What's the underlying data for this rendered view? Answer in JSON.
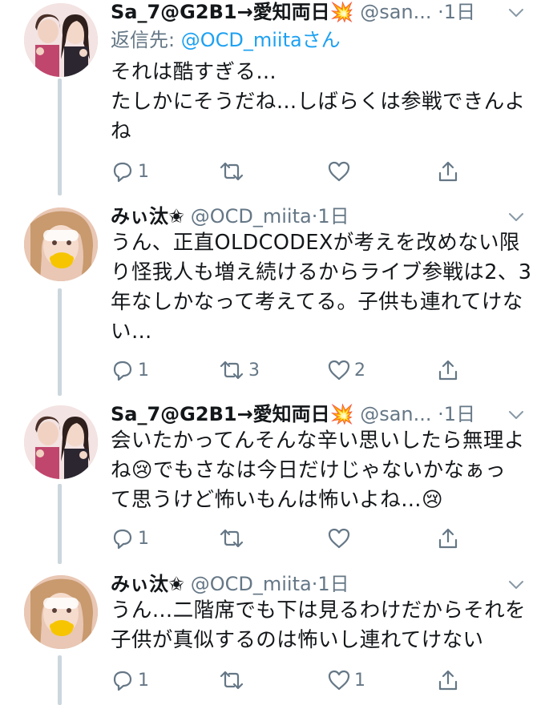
{
  "tweets": [
    {
      "name": "Sa_7@G2B1→愛知両日💥",
      "handle": "@san...",
      "time": "1日",
      "reply_prefix": "返信先: ",
      "reply_handle": "@OCD_miitaさん",
      "lines": [
        "それは酷すぎる…",
        "たしかにそうだね…しばらくは参戦できんよ",
        "ね"
      ],
      "reply_count": "1",
      "retweet_count": "",
      "like_count": ""
    },
    {
      "name": "みぃ汰✬",
      "handle": "@OCD_miita",
      "time": "1日",
      "lines": [
        "うん、正直OLDCODEXが考えを改めない限",
        "り怪我人も増え続けるからライブ参戦は2、3",
        "年なしかなって考えてる。子供も連れてけな",
        "い…"
      ],
      "reply_count": "1",
      "retweet_count": "3",
      "like_count": "2"
    },
    {
      "name": "Sa_7@G2B1→愛知両日💥",
      "handle": "@san...",
      "time": "1日",
      "lines": [
        "会いたかってんそんな辛い思いしたら無理よ",
        "ね😢でもさなは今日だけじゃないかなぁっ",
        "て思うけど怖いもんは怖いよね…😢"
      ],
      "reply_count": "1",
      "retweet_count": "",
      "like_count": ""
    },
    {
      "name": "みぃ汰✬",
      "handle": "@OCD_miita",
      "time": "1日",
      "lines": [
        "うん…二階席でも下は見るわけだからそれを",
        "子供が真似するのは怖いし連れてけない"
      ],
      "reply_count": "1",
      "retweet_count": "",
      "like_count": "1"
    }
  ],
  "icons": [
    "reply-icon",
    "retweet-icon",
    "like-icon",
    "share-icon",
    "chevron-down-icon"
  ],
  "colors": {
    "text": "#14171a",
    "secondary": "#657786",
    "link": "#1da1f2",
    "thread_line": "#ccd6dd"
  }
}
